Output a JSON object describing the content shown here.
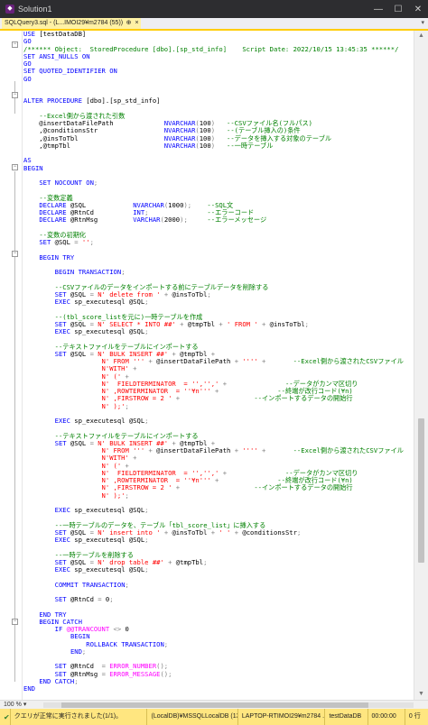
{
  "window": {
    "title": "Solution1",
    "minimize": "—",
    "maximize": "☐",
    "close": "✕"
  },
  "tab": {
    "label": "SQLQuery3.sql - (L...IMOI29¥m2784 (55))",
    "pin": "⊕",
    "close": "×",
    "dropdown": "▾"
  },
  "code_lines": [
    [
      [
        "k",
        "USE "
      ],
      [
        "t",
        "[testDataDB]"
      ]
    ],
    [
      [
        "k",
        "GO"
      ]
    ],
    [
      [
        "c",
        "/****** Object:  StoredProcedure [dbo].[sp_std_info]    Script Date: 2022/10/15 13:45:35 ******/"
      ]
    ],
    [
      [
        "k",
        "SET ANSI_NULLS ON"
      ]
    ],
    [
      [
        "k",
        "GO"
      ]
    ],
    [
      [
        "k",
        "SET QUOTED_IDENTIFIER ON"
      ]
    ],
    [
      [
        "k",
        "GO"
      ]
    ],
    [],
    [],
    [
      [
        "k",
        "ALTER PROCEDURE "
      ],
      [
        "t",
        "[dbo].[sp_std_info]"
      ]
    ],
    [],
    [
      [
        "t",
        "    "
      ],
      [
        "c",
        "--Excel側から渡された引数"
      ]
    ],
    [
      [
        "t",
        "    @insertDataFilePath             "
      ],
      [
        "k",
        "NVARCHAR"
      ],
      [
        "g",
        "("
      ],
      [
        "t",
        "100"
      ],
      [
        "g",
        ")"
      ],
      [
        "t",
        "   "
      ],
      [
        "c",
        "--CSVファイル名(フルパス)"
      ]
    ],
    [
      [
        "t",
        "    ,@conditionsStr                 "
      ],
      [
        "k",
        "NVARCHAR"
      ],
      [
        "g",
        "("
      ],
      [
        "t",
        "100"
      ],
      [
        "g",
        ")"
      ],
      [
        "t",
        "   "
      ],
      [
        "c",
        "--(テーブル挿入の)条件"
      ]
    ],
    [
      [
        "t",
        "    ,@insToTbl                      "
      ],
      [
        "k",
        "NVARCHAR"
      ],
      [
        "g",
        "("
      ],
      [
        "t",
        "100"
      ],
      [
        "g",
        ")"
      ],
      [
        "t",
        "   "
      ],
      [
        "c",
        "--データを挿入する対象のテーブル"
      ]
    ],
    [
      [
        "t",
        "    ,@tmpTbl                        "
      ],
      [
        "k",
        "NVARCHAR"
      ],
      [
        "g",
        "("
      ],
      [
        "t",
        "100"
      ],
      [
        "g",
        ")"
      ],
      [
        "t",
        "   "
      ],
      [
        "c",
        "--一時テーブル"
      ]
    ],
    [],
    [
      [
        "k",
        "AS"
      ]
    ],
    [
      [
        "k",
        "BEGIN"
      ]
    ],
    [],
    [
      [
        "t",
        "    "
      ],
      [
        "k",
        "SET NOCOUNT ON"
      ],
      [
        "g",
        ";"
      ]
    ],
    [],
    [
      [
        "t",
        "    "
      ],
      [
        "c",
        "--変数定義"
      ]
    ],
    [
      [
        "t",
        "    "
      ],
      [
        "k",
        "DECLARE"
      ],
      [
        "t",
        " @SQL            "
      ],
      [
        "k",
        "NVARCHAR"
      ],
      [
        "g",
        "("
      ],
      [
        "t",
        "1000"
      ],
      [
        "g",
        ");"
      ],
      [
        "t",
        "    "
      ],
      [
        "c",
        "--SQL文"
      ]
    ],
    [
      [
        "t",
        "    "
      ],
      [
        "k",
        "DECLARE"
      ],
      [
        "t",
        " @RtnCd          "
      ],
      [
        "k",
        "INT"
      ],
      [
        "g",
        ";"
      ],
      [
        "t",
        "               "
      ],
      [
        "c",
        "--エラーコード"
      ]
    ],
    [
      [
        "t",
        "    "
      ],
      [
        "k",
        "DECLARE"
      ],
      [
        "t",
        " @RtnMsg         "
      ],
      [
        "k",
        "VARCHAR"
      ],
      [
        "g",
        "("
      ],
      [
        "t",
        "2000"
      ],
      [
        "g",
        ");"
      ],
      [
        "t",
        "     "
      ],
      [
        "c",
        "--エラーメッセージ"
      ]
    ],
    [],
    [
      [
        "t",
        "    "
      ],
      [
        "c",
        "--変数の初期化"
      ]
    ],
    [
      [
        "t",
        "    "
      ],
      [
        "k",
        "SET"
      ],
      [
        "t",
        " @SQL "
      ],
      [
        "g",
        "="
      ],
      [
        "t",
        " "
      ],
      [
        "s",
        "''"
      ],
      [
        "g",
        ";"
      ]
    ],
    [],
    [
      [
        "t",
        "    "
      ],
      [
        "k",
        "BEGIN TRY"
      ]
    ],
    [],
    [
      [
        "t",
        "        "
      ],
      [
        "k",
        "BEGIN TRANSACTION"
      ],
      [
        "g",
        ";"
      ]
    ],
    [],
    [
      [
        "t",
        "        "
      ],
      [
        "c",
        "--CSVファイルのデータをインポートする前にテーブルデータを削除する"
      ]
    ],
    [
      [
        "t",
        "        "
      ],
      [
        "k",
        "SET"
      ],
      [
        "t",
        " @SQL "
      ],
      [
        "g",
        "="
      ],
      [
        "t",
        " "
      ],
      [
        "s",
        "N' delete from '"
      ],
      [
        "t",
        " "
      ],
      [
        "g",
        "+"
      ],
      [
        "t",
        " @insToTbl"
      ],
      [
        "g",
        ";"
      ]
    ],
    [
      [
        "t",
        "        "
      ],
      [
        "k",
        "EXEC"
      ],
      [
        "t",
        " sp_executesql @SQL"
      ],
      [
        "g",
        ";"
      ]
    ],
    [],
    [
      [
        "t",
        "        "
      ],
      [
        "c",
        "--(tbl_score_listを元に)一時テーブルを作成"
      ]
    ],
    [
      [
        "t",
        "        "
      ],
      [
        "k",
        "SET"
      ],
      [
        "t",
        " @SQL "
      ],
      [
        "g",
        "="
      ],
      [
        "t",
        " "
      ],
      [
        "s",
        "N' SELECT * INTO ##'"
      ],
      [
        "t",
        " "
      ],
      [
        "g",
        "+"
      ],
      [
        "t",
        " @tmpTbl "
      ],
      [
        "g",
        "+"
      ],
      [
        "t",
        " "
      ],
      [
        "s",
        "' FROM '"
      ],
      [
        "t",
        " "
      ],
      [
        "g",
        "+"
      ],
      [
        "t",
        " @insToTbl"
      ],
      [
        "g",
        ";"
      ]
    ],
    [
      [
        "t",
        "        "
      ],
      [
        "k",
        "EXEC"
      ],
      [
        "t",
        " sp_executesql @SQL"
      ],
      [
        "g",
        ";"
      ]
    ],
    [],
    [
      [
        "t",
        "        "
      ],
      [
        "c",
        "--テキストファイルをテーブルにインポートする"
      ]
    ],
    [
      [
        "t",
        "        "
      ],
      [
        "k",
        "SET"
      ],
      [
        "t",
        " @SQL "
      ],
      [
        "g",
        "="
      ],
      [
        "t",
        " "
      ],
      [
        "s",
        "N' BULK INSERT ##'"
      ],
      [
        "t",
        " "
      ],
      [
        "g",
        "+"
      ],
      [
        "t",
        " @tmpTbl "
      ],
      [
        "g",
        "+"
      ]
    ],
    [
      [
        "t",
        "                    "
      ],
      [
        "s",
        "N' FROM '''"
      ],
      [
        "t",
        " "
      ],
      [
        "g",
        "+"
      ],
      [
        "t",
        " @insertDataFilePath "
      ],
      [
        "g",
        "+"
      ],
      [
        "t",
        " "
      ],
      [
        "s",
        "''''"
      ],
      [
        "t",
        " "
      ],
      [
        "g",
        "+"
      ],
      [
        "t",
        "       "
      ],
      [
        "c",
        "--Excel側から渡されたCSVファイル"
      ]
    ],
    [
      [
        "t",
        "                    "
      ],
      [
        "s",
        "N'WITH'"
      ],
      [
        "t",
        " "
      ],
      [
        "g",
        "+"
      ]
    ],
    [
      [
        "t",
        "                    "
      ],
      [
        "s",
        "N' ('"
      ],
      [
        "t",
        " "
      ],
      [
        "g",
        "+"
      ]
    ],
    [
      [
        "t",
        "                    "
      ],
      [
        "s",
        "N'  FIELDTERMINATOR  = '','','"
      ],
      [
        "t",
        " "
      ],
      [
        "g",
        "+"
      ],
      [
        "t",
        "               "
      ],
      [
        "c",
        "--データがカンマ区切り"
      ]
    ],
    [
      [
        "t",
        "                    "
      ],
      [
        "s",
        "N' ,ROWTERMINATOR  = ''¥n'''"
      ],
      [
        "t",
        " "
      ],
      [
        "g",
        "+"
      ],
      [
        "t",
        "               "
      ],
      [
        "c",
        "--終端が改行コード(¥n)"
      ]
    ],
    [
      [
        "t",
        "                    "
      ],
      [
        "s",
        "N' ,FIRSTROW = 2 '"
      ],
      [
        "t",
        " "
      ],
      [
        "g",
        "+"
      ],
      [
        "t",
        "                   "
      ],
      [
        "c",
        "--インポートするデータの開始行"
      ]
    ],
    [
      [
        "t",
        "                    "
      ],
      [
        "s",
        "N' );'"
      ],
      [
        "g",
        ";"
      ]
    ],
    [],
    [
      [
        "t",
        "        "
      ],
      [
        "k",
        "EXEC"
      ],
      [
        "t",
        " sp_executesql @SQL"
      ],
      [
        "g",
        ";"
      ]
    ],
    [],
    [
      [
        "t",
        "        "
      ],
      [
        "c",
        "--テキストファイルをテーブルにインポートする"
      ]
    ],
    [
      [
        "t",
        "        "
      ],
      [
        "k",
        "SET"
      ],
      [
        "t",
        " @SQL "
      ],
      [
        "g",
        "="
      ],
      [
        "t",
        " "
      ],
      [
        "s",
        "N' BULK INSERT ##'"
      ],
      [
        "t",
        " "
      ],
      [
        "g",
        "+"
      ],
      [
        "t",
        " @tmpTbl "
      ],
      [
        "g",
        "+"
      ]
    ],
    [
      [
        "t",
        "                    "
      ],
      [
        "s",
        "N' FROM '''"
      ],
      [
        "t",
        " "
      ],
      [
        "g",
        "+"
      ],
      [
        "t",
        " @insertDataFilePath "
      ],
      [
        "g",
        "+"
      ],
      [
        "t",
        " "
      ],
      [
        "s",
        "''''"
      ],
      [
        "t",
        " "
      ],
      [
        "g",
        "+"
      ],
      [
        "t",
        "       "
      ],
      [
        "c",
        "--Excel側から渡されたCSVファイル"
      ]
    ],
    [
      [
        "t",
        "                    "
      ],
      [
        "s",
        "N'WITH'"
      ],
      [
        "t",
        " "
      ],
      [
        "g",
        "+"
      ]
    ],
    [
      [
        "t",
        "                    "
      ],
      [
        "s",
        "N' ('"
      ],
      [
        "t",
        " "
      ],
      [
        "g",
        "+"
      ]
    ],
    [
      [
        "t",
        "                    "
      ],
      [
        "s",
        "N'  FIELDTERMINATOR  = '','','"
      ],
      [
        "t",
        " "
      ],
      [
        "g",
        "+"
      ],
      [
        "t",
        "               "
      ],
      [
        "c",
        "--データがカンマ区切り"
      ]
    ],
    [
      [
        "t",
        "                    "
      ],
      [
        "s",
        "N' ,ROWTERMINATOR  = ''¥n'''"
      ],
      [
        "t",
        " "
      ],
      [
        "g",
        "+"
      ],
      [
        "t",
        "               "
      ],
      [
        "c",
        "--終端が改行コード(¥n)"
      ]
    ],
    [
      [
        "t",
        "                    "
      ],
      [
        "s",
        "N' ,FIRSTROW = 2 '"
      ],
      [
        "t",
        " "
      ],
      [
        "g",
        "+"
      ],
      [
        "t",
        "                   "
      ],
      [
        "c",
        "--インポートするデータの開始行"
      ]
    ],
    [
      [
        "t",
        "                    "
      ],
      [
        "s",
        "N' );'"
      ],
      [
        "g",
        ";"
      ]
    ],
    [],
    [
      [
        "t",
        "        "
      ],
      [
        "k",
        "EXEC"
      ],
      [
        "t",
        " sp_executesql @SQL"
      ],
      [
        "g",
        ";"
      ]
    ],
    [],
    [
      [
        "t",
        "        "
      ],
      [
        "c",
        "--一時テーブルのデータを、テーブル「tbl_score_list」に挿入する"
      ]
    ],
    [
      [
        "t",
        "        "
      ],
      [
        "k",
        "SET"
      ],
      [
        "t",
        " @SQL "
      ],
      [
        "g",
        "="
      ],
      [
        "t",
        " "
      ],
      [
        "s",
        "N' insert into '"
      ],
      [
        "t",
        " "
      ],
      [
        "g",
        "+"
      ],
      [
        "t",
        " @insToTbl "
      ],
      [
        "g",
        "+"
      ],
      [
        "t",
        " "
      ],
      [
        "s",
        "' '"
      ],
      [
        "t",
        " "
      ],
      [
        "g",
        "+"
      ],
      [
        "t",
        " @conditionsStr"
      ],
      [
        "g",
        ";"
      ]
    ],
    [
      [
        "t",
        "        "
      ],
      [
        "k",
        "EXEC"
      ],
      [
        "t",
        " sp_executesql @SQL"
      ],
      [
        "g",
        ";"
      ]
    ],
    [],
    [
      [
        "t",
        "        "
      ],
      [
        "c",
        "--一時テーブルを削除する"
      ]
    ],
    [
      [
        "t",
        "        "
      ],
      [
        "k",
        "SET"
      ],
      [
        "t",
        " @SQL "
      ],
      [
        "g",
        "="
      ],
      [
        "t",
        " "
      ],
      [
        "s",
        "N' drop table ##'"
      ],
      [
        "t",
        " "
      ],
      [
        "g",
        "+"
      ],
      [
        "t",
        " @tmpTbl"
      ],
      [
        "g",
        ";"
      ]
    ],
    [
      [
        "t",
        "        "
      ],
      [
        "k",
        "EXEC"
      ],
      [
        "t",
        " sp_executesql @SQL"
      ],
      [
        "g",
        ";"
      ]
    ],
    [],
    [
      [
        "t",
        "        "
      ],
      [
        "k",
        "COMMIT TRANSACTION"
      ],
      [
        "g",
        ";"
      ]
    ],
    [],
    [
      [
        "t",
        "        "
      ],
      [
        "k",
        "SET"
      ],
      [
        "t",
        " @RtnCd "
      ],
      [
        "g",
        "="
      ],
      [
        "t",
        " 0"
      ],
      [
        "g",
        ";"
      ]
    ],
    [],
    [
      [
        "t",
        "    "
      ],
      [
        "k",
        "END TRY"
      ]
    ],
    [
      [
        "t",
        "    "
      ],
      [
        "k",
        "BEGIN CATCH"
      ]
    ],
    [
      [
        "t",
        "        "
      ],
      [
        "k",
        "IF"
      ],
      [
        "t",
        " "
      ],
      [
        "f",
        "@@TRANCOUNT"
      ],
      [
        "t",
        " "
      ],
      [
        "g",
        "<>"
      ],
      [
        "t",
        " 0"
      ]
    ],
    [
      [
        "t",
        "            "
      ],
      [
        "k",
        "BEGIN"
      ]
    ],
    [
      [
        "t",
        "                "
      ],
      [
        "k",
        "ROLLBACK TRANSACTION"
      ],
      [
        "g",
        ";"
      ]
    ],
    [
      [
        "t",
        "            "
      ],
      [
        "k",
        "END"
      ],
      [
        "g",
        ";"
      ]
    ],
    [],
    [
      [
        "t",
        "        "
      ],
      [
        "k",
        "SET"
      ],
      [
        "t",
        " @RtnCd  "
      ],
      [
        "g",
        "="
      ],
      [
        "t",
        " "
      ],
      [
        "f",
        "ERROR_NUMBER"
      ],
      [
        "g",
        "();"
      ]
    ],
    [
      [
        "t",
        "        "
      ],
      [
        "k",
        "SET"
      ],
      [
        "t",
        " @RtnMsg "
      ],
      [
        "g",
        "="
      ],
      [
        "t",
        " "
      ],
      [
        "f",
        "ERROR_MESSAGE"
      ],
      [
        "g",
        "();"
      ]
    ],
    [
      [
        "t",
        "    "
      ],
      [
        "k",
        "END CATCH"
      ],
      [
        "g",
        ";"
      ]
    ],
    [
      [
        "k",
        "END"
      ]
    ]
  ],
  "bottom": {
    "zoom": "100 %",
    "zoom_arrow": "▾"
  },
  "status": {
    "check": "✔",
    "message": "クエリが正常に実行されました(1/1)。",
    "server": "(LocalDB)¥MSSQLLocalDB (13....",
    "user": "LAPTOP-RTIMOI29¥m2784 ...",
    "database": "testDataDB",
    "elapsed": "00:00:00",
    "rows": "0 行"
  },
  "colors": {
    "keyword": "#0000ff",
    "string": "#ff0000",
    "comment": "#008000",
    "function": "#ff00ff",
    "operator": "#808080",
    "tab_active": "#fff1a5",
    "status_bar": "#ffe680"
  }
}
